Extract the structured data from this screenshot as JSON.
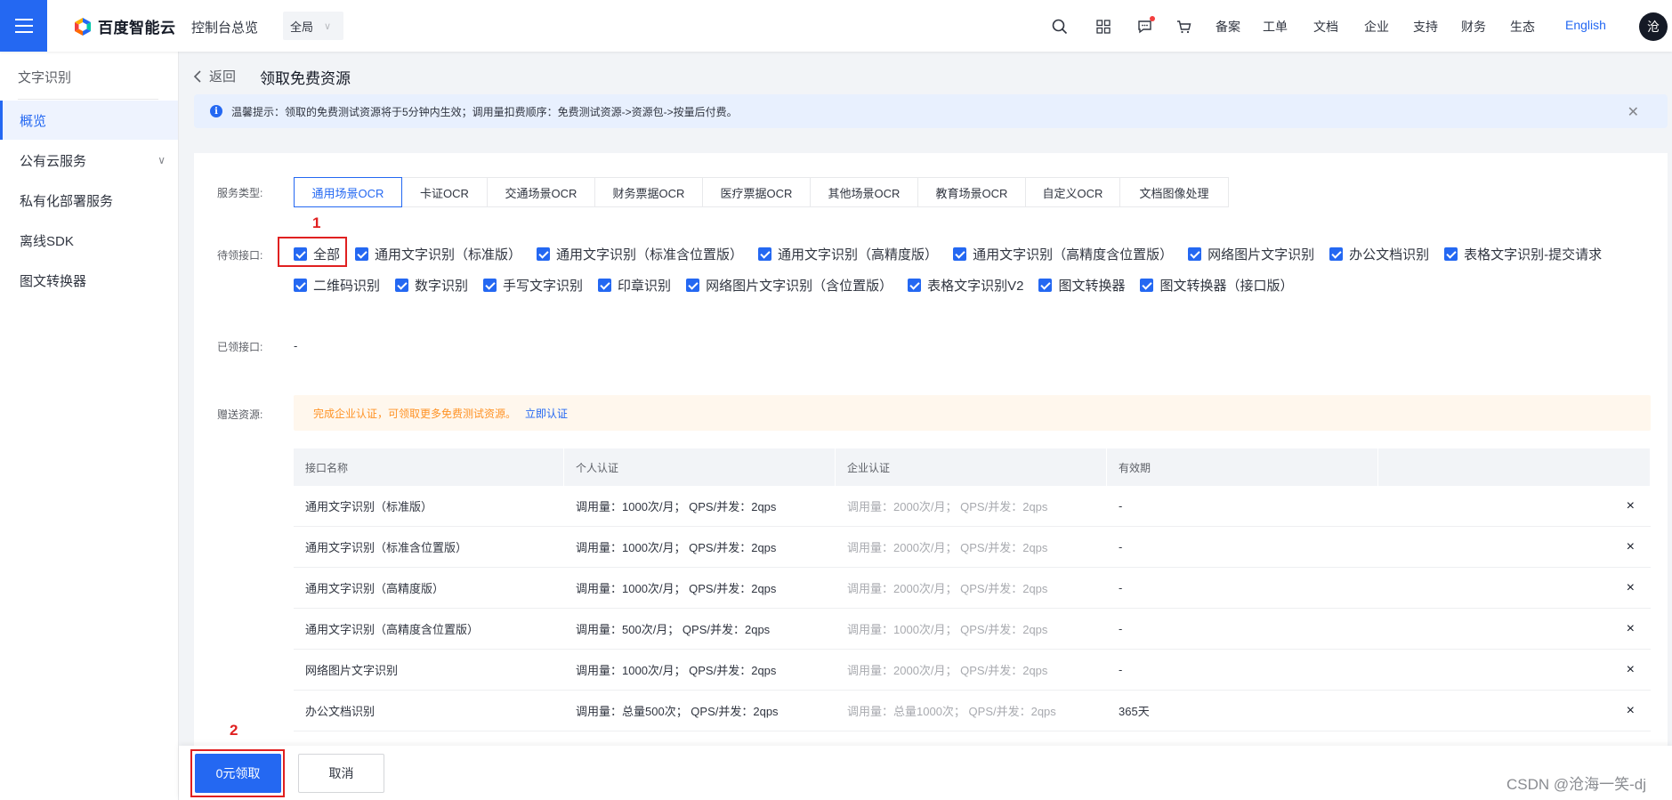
{
  "topbar": {
    "brand": "百度智能云",
    "console": "控制台总览",
    "region": "全局",
    "nav": [
      "备案",
      "工单",
      "文档",
      "企业",
      "支持",
      "财务",
      "生态"
    ],
    "language": "English",
    "avatar": "沧"
  },
  "sidebar": {
    "title": "文字识别",
    "items": [
      {
        "label": "概览"
      },
      {
        "label": "公有云服务"
      },
      {
        "label": "私有化部署服务"
      },
      {
        "label": "离线SDK"
      },
      {
        "label": "图文转换器"
      }
    ]
  },
  "header": {
    "back": "返回",
    "title": "领取免费资源"
  },
  "notice": {
    "text": "温馨提示：领取的免费测试资源将于5分钟内生效；调用量扣费顺序：免费测试资源->资源包->按量后付费。"
  },
  "form": {
    "service_type_label": "服务类型:",
    "tabs": [
      "通用场景OCR",
      "卡证OCR",
      "交通场景OCR",
      "财务票据OCR",
      "医疗票据OCR",
      "其他场景OCR",
      "教育场景OCR",
      "自定义OCR",
      "文档图像处理"
    ],
    "pending_label": "待领接口:",
    "select_all": "全部",
    "apis_row1": [
      "通用文字识别（标准版）",
      "通用文字识别（标准含位置版）",
      "通用文字识别（高精度版）",
      "通用文字识别（高精度含位置版）",
      "网络图片文字识别",
      "办公文档识别",
      "表格文字识别-提交请求"
    ],
    "apis_row2": [
      "二维码识别",
      "数字识别",
      "手写文字识别",
      "印章识别",
      "网络图片文字识别（含位置版）",
      "表格文字识别V2",
      "图文转换器",
      "图文转换器（接口版）"
    ],
    "received_label": "已领接口:",
    "received_value": "-",
    "gift_label": "赠送资源:",
    "gift_banner": "完成企业认证，可领取更多免费测试资源。",
    "gift_link": "立即认证"
  },
  "table": {
    "headers": [
      "接口名称",
      "个人认证",
      "企业认证",
      "有效期",
      ""
    ],
    "rows": [
      [
        "通用文字识别（标准版）",
        "调用量：1000次/月； QPS/并发：2qps",
        "调用量：2000次/月； QPS/并发：2qps",
        "-"
      ],
      [
        "通用文字识别（标准含位置版）",
        "调用量：1000次/月； QPS/并发：2qps",
        "调用量：2000次/月； QPS/并发：2qps",
        "-"
      ],
      [
        "通用文字识别（高精度版）",
        "调用量：1000次/月； QPS/并发：2qps",
        "调用量：2000次/月； QPS/并发：2qps",
        "-"
      ],
      [
        "通用文字识别（高精度含位置版）",
        "调用量：500次/月； QPS/并发：2qps",
        "调用量：1000次/月； QPS/并发：2qps",
        "-"
      ],
      [
        "网络图片文字识别",
        "调用量：1000次/月； QPS/并发：2qps",
        "调用量：2000次/月； QPS/并发：2qps",
        "-"
      ],
      [
        "办公文档识别",
        "调用量：总量500次； QPS/并发：2qps",
        "调用量：总量1000次； QPS/并发：2qps",
        "365天"
      ]
    ],
    "remove_symbol": "×"
  },
  "footer": {
    "claim": "0元领取",
    "cancel": "取消"
  },
  "annotations": {
    "step1": "1",
    "step2": "2"
  },
  "watermark": "CSDN @沧海一笑-dj",
  "colors": {
    "accent": "#2468f2",
    "highlight": "#e02020",
    "warning_text": "#ff9326"
  }
}
